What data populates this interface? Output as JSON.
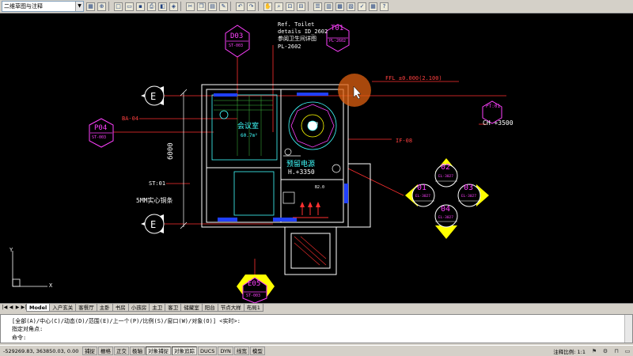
{
  "toolbar": {
    "workspace": "二维草图与注释",
    "buttons": [
      "grid-icon",
      "zoom-icon",
      "new-icon",
      "open-icon",
      "save-icon",
      "print-icon",
      "preview-icon",
      "publish-icon",
      "cut-icon",
      "copy-icon",
      "paste-icon",
      "matchprop-icon",
      "undo-icon",
      "redo-icon",
      "pan-icon",
      "zoom-realtime-icon",
      "zoom-window-icon",
      "zoom-prev-icon",
      "properties-icon",
      "designcenter-icon",
      "toolpalette-icon",
      "sheetset-icon",
      "markup-icon",
      "calc-icon",
      "help-icon"
    ]
  },
  "drawing": {
    "room_name": "会议室",
    "room_area": "60.7m²",
    "power_label": "预留电源",
    "power_height": "H.+3350",
    "dimension": "6000",
    "strip_label": "5MM实心铜条",
    "ba_label": "BA-04",
    "ifo_label": "IF-08",
    "ffl_label": "FFL ±0.000(2.100)",
    "ch_label": "CH +3500",
    "pt_label": "PT:01",
    "st_label": "ST:01",
    "ref_note": [
      "Ref. Toilet",
      "details  ID_2602",
      "参阅卫生间详图",
      "PL-2602"
    ],
    "tags": {
      "d03": {
        "code": "D03",
        "ref": "ST-003"
      },
      "t01": {
        "code": "T01",
        "ref": "PL-2602"
      },
      "p04": {
        "code": "P04",
        "ref": "ST-003"
      },
      "e05": {
        "code": "E05",
        "ref": "ST-003"
      }
    },
    "elevation_markers": {
      "top": "02",
      "left": "01",
      "right": "03",
      "bottom": "04",
      "ref": "EL-3027"
    },
    "section_marks": [
      "E",
      "E"
    ],
    "small_labels": [
      "DA-0",
      "B2.0"
    ]
  },
  "tabs": {
    "items": [
      "Model",
      "入户玄关",
      "客餐厅",
      "主卧",
      "书房",
      "小孩房",
      "主卫",
      "客卫",
      "储藏室",
      "阳台",
      "节点大样",
      "布局1"
    ],
    "active_index": 0
  },
  "command": {
    "line1": "[全部(A)/中心(C)/动态(D)/范围(E)/上一个(P)/比例(S)/窗口(W)/对象(O)] <实时>:",
    "line2": "指定对角点:",
    "line3": "命令:"
  },
  "status": {
    "coords": "-529269.83, 363850.03, 0.00",
    "toggles": [
      "捕捉",
      "栅格",
      "正交",
      "极轴",
      "对象捕捉",
      "对象追踪",
      "DUCS",
      "DYN",
      "线宽",
      "模型"
    ],
    "annotation_scale": "注释比例: 1:1"
  },
  "colors": {
    "background": "#000000",
    "wall": "#ffffff",
    "accent_red": "#ff3030",
    "accent_magenta": "#ff40ff",
    "accent_cyan": "#40ffff",
    "accent_yellow": "#ffff00",
    "cursor_highlight": "#e06010"
  }
}
